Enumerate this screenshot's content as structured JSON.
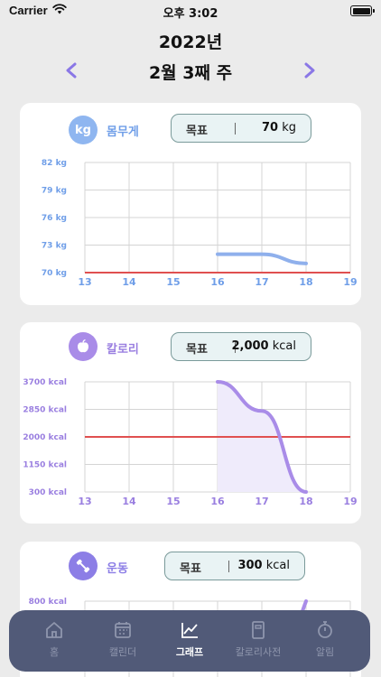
{
  "status_bar": {
    "carrier": "Carrier",
    "time": "오후 3:02"
  },
  "header": {
    "year": "2022년",
    "week": "2월 3째 주"
  },
  "cards": [
    {
      "title": "몸무게",
      "icon_text": "kg",
      "icon_color": "#8fb6f0",
      "goal_label": "목표",
      "goal_value": "70",
      "goal_unit": "kg"
    },
    {
      "title": "칼로리",
      "icon": "apple-icon",
      "icon_color": "#a98ce8",
      "goal_label": "목표",
      "goal_value": "2,000",
      "goal_unit": "kcal"
    },
    {
      "title": "운동",
      "icon": "dumbbell-icon",
      "icon_color": "#8c7ee6",
      "goal_label": "목표",
      "goal_value": "300",
      "goal_unit": "kcal"
    }
  ],
  "chart_data": [
    {
      "type": "line",
      "title": "몸무게",
      "x_ticks": [
        13,
        14,
        15,
        16,
        17,
        18,
        19
      ],
      "y_ticks": [
        "82 kg",
        "79 kg",
        "76 kg",
        "73 kg",
        "70 kg"
      ],
      "y_tick_values": [
        82,
        79,
        76,
        73,
        70
      ],
      "ylim": [
        70,
        82
      ],
      "xlim": [
        13,
        19
      ],
      "series": [
        {
          "x": [
            16,
            17,
            18
          ],
          "y": [
            72,
            72,
            71
          ]
        }
      ],
      "goal_line": 70,
      "colors": {
        "line": "#8fb0ec",
        "axis_label": "#6f9ee8",
        "goal": "#e05050"
      },
      "grid": true
    },
    {
      "type": "area",
      "title": "칼로리",
      "x_ticks": [
        13,
        14,
        15,
        16,
        17,
        18,
        19
      ],
      "y_ticks": [
        "3700 kcal",
        "2850 kcal",
        "2000 kcal",
        "1150 kcal",
        "300 kcal"
      ],
      "y_tick_values": [
        3700,
        2850,
        2000,
        1150,
        300
      ],
      "ylim": [
        300,
        3700
      ],
      "xlim": [
        13,
        19
      ],
      "series": [
        {
          "x": [
            16,
            17,
            18
          ],
          "y": [
            3700,
            2800,
            300
          ]
        }
      ],
      "goal_line": 2000,
      "colors": {
        "line": "#a98ce8",
        "fill": "#efebfb",
        "axis_label": "#9a7fe0",
        "goal": "#e05050"
      },
      "grid": true
    },
    {
      "type": "line",
      "title": "운동",
      "y_ticks": [
        "800 kcal"
      ],
      "colors": {
        "line": "#a98ce8",
        "axis_label": "#9a7fe0"
      }
    }
  ],
  "tabbar": {
    "items": [
      {
        "label": "홈",
        "icon": "home-icon"
      },
      {
        "label": "캘린더",
        "icon": "calendar-icon"
      },
      {
        "label": "그래프",
        "icon": "graph-icon",
        "active": true
      },
      {
        "label": "칼로리사전",
        "icon": "book-icon"
      },
      {
        "label": "알림",
        "icon": "timer-icon"
      }
    ]
  }
}
